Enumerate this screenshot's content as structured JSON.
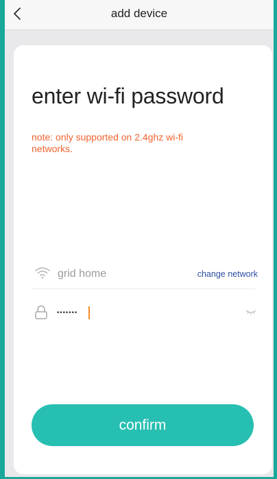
{
  "nav": {
    "title": "add device",
    "back_icon": "chevron-left-icon"
  },
  "main": {
    "heading": "enter wi-fi password",
    "note": "note: only supported on 2.4ghz wi-fi networks."
  },
  "network": {
    "icon": "wifi-icon",
    "ssid": "grid home",
    "change_label": "change network"
  },
  "password": {
    "icon": "lock-icon",
    "value": "•••••••",
    "visibility_icon": "eye-closed-icon"
  },
  "confirm_button": {
    "label": "confirm"
  },
  "colors": {
    "accent": "#27bfb1",
    "frame": "#1aa89b",
    "note": "#f0632f",
    "link": "#2d4fa0",
    "caret": "#f28c28"
  }
}
